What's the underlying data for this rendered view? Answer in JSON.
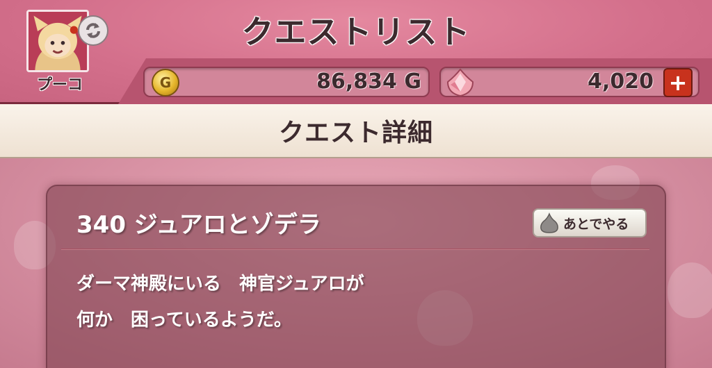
{
  "header": {
    "title": "クエストリスト",
    "character_name": "プーコ"
  },
  "currency": {
    "gold_icon_letter": "G",
    "gold": "86,834 G",
    "gems": "4,020",
    "add_label": "+"
  },
  "section": {
    "title": "クエスト詳細"
  },
  "quest": {
    "title": "340 ジュアロとゾデラ",
    "later_button": "あとでやる",
    "description_line1": "ダーマ神殿にいる　神官ジュアロが",
    "description_line2": "何か　困っているようだ。"
  },
  "colors": {
    "header_pink": "#d36f8b",
    "section_bar": "#faf3ea",
    "card": "#7a3c48",
    "plus_red": "#c8321d",
    "gold": "#e6b62c"
  },
  "icons": {
    "avatar": "character-portrait",
    "refresh": "refresh-icon",
    "gold": "gold-coin-icon",
    "gem": "gem-icon",
    "slime": "slime-icon"
  }
}
